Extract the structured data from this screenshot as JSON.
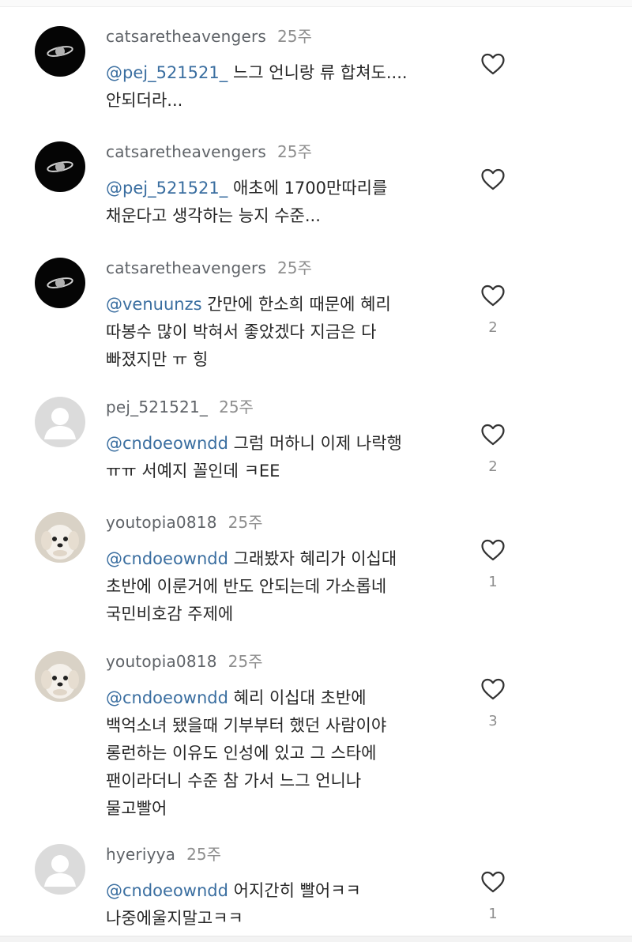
{
  "comments": [
    {
      "username": "catsaretheavengers",
      "time": "25주",
      "mention": "@pej_521521_",
      "line1": "느그 언니랑 류 합쳐도....",
      "line2": "안되더라...",
      "likes": "",
      "avatar": "saturn-avatar"
    },
    {
      "username": "catsaretheavengers",
      "time": "25주",
      "mention": "@pej_521521_",
      "line1": "애초에 1700만따리를",
      "line2": "채운다고 생각하는 능지 수준...",
      "likes": "",
      "avatar": "saturn-avatar"
    },
    {
      "username": "catsaretheavengers",
      "time": "25주",
      "mention": "@venuunzs",
      "line1": "간만에 한소희 때문에 혜리",
      "line2": "따봉수 많이 박혀서 좋았겠다 지금은 다",
      "line3": "빠졌지만 ㅠ 힝",
      "likes": "2",
      "avatar": "saturn-avatar"
    },
    {
      "username": "pej_521521_",
      "time": "25주",
      "mention": "@cndoeowndd",
      "line1": "그럼 머하니 이제 나락행",
      "line2": "ㅠㅠ 서예지 꼴인데 ㅋEE",
      "likes": "2",
      "avatar": "default-avatar"
    },
    {
      "username": "youtopia0818",
      "time": "25주",
      "mention": "@cndoeowndd",
      "line1": "그래봤자 혜리가 이십대",
      "line2": "초반에 이룬거에 반도 안되는데 가소롭네",
      "line3": "국민비호감 주제에",
      "likes": "1",
      "avatar": "dog-avatar"
    },
    {
      "username": "youtopia0818",
      "time": "25주",
      "mention": "@cndoeowndd",
      "line1": "혜리 이십대 초반에",
      "line2": "백억소녀 됐을때 기부부터 했던 사람이야",
      "line3": "롱런하는 이유도 인성에 있고 그 스타에",
      "line4": "팬이라더니 수준 참 가서 느그 언니나",
      "line5": "물고빨어",
      "likes": "3",
      "avatar": "dog-avatar"
    },
    {
      "username": "hyeriyya",
      "time": "25주",
      "mention": "@cndoeowndd",
      "line1": "어지간히 빨어ㅋㅋ",
      "line2": "나중에울지말고ㅋㅋ",
      "likes": "1",
      "avatar": "default-avatar"
    }
  ]
}
